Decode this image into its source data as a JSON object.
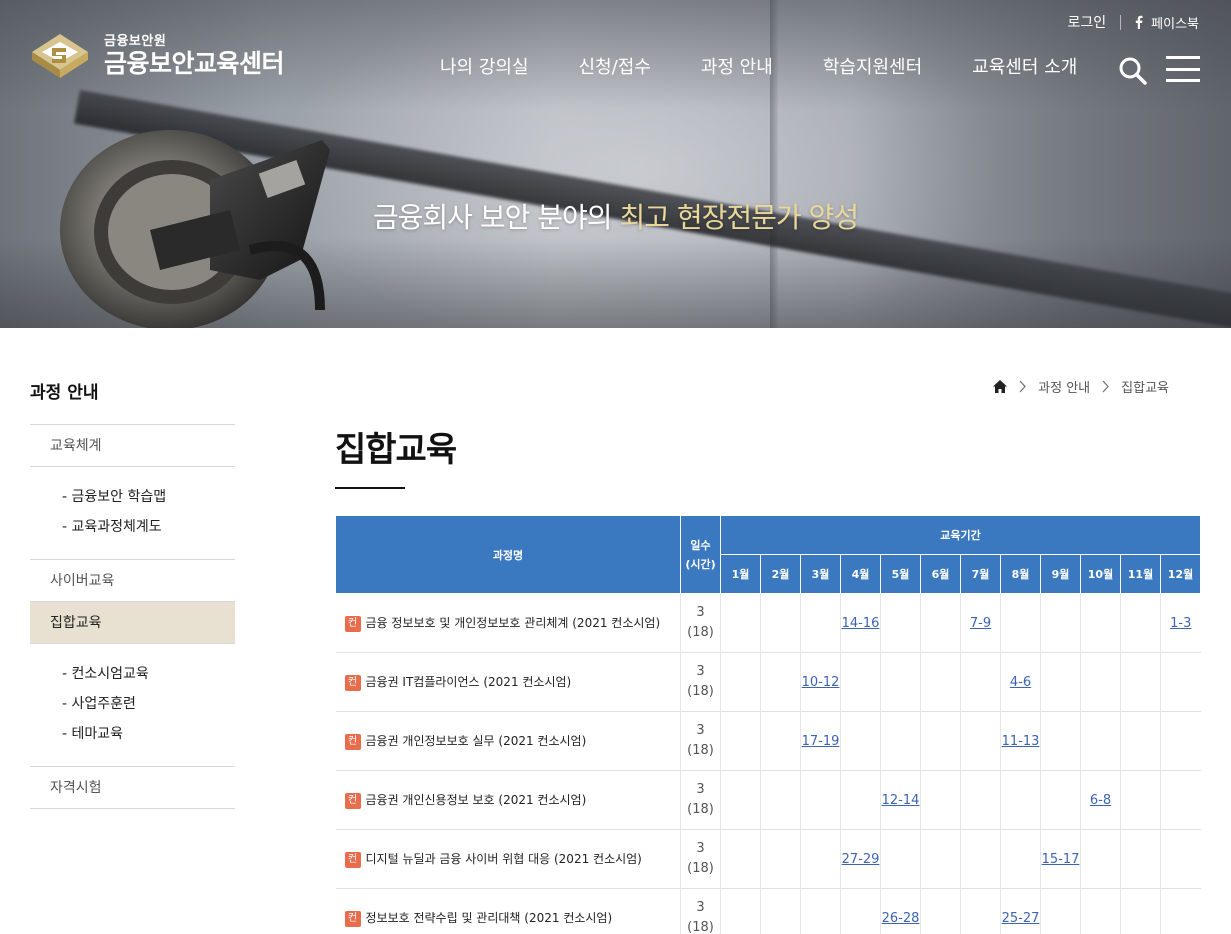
{
  "header": {
    "org": "금융보안원",
    "site_title": "금융보안교육센터",
    "login": "로그인",
    "facebook": "페이스북",
    "nav": [
      "나의 강의실",
      "신청/접수",
      "과정 안내",
      "학습지원센터",
      "교육센터 소개"
    ]
  },
  "hero": {
    "slogan_prefix": "금융회사 보안 분야의 ",
    "slogan_highlight": "최고 현장전문가 양성"
  },
  "sidebar": {
    "title": "과정 안내",
    "items": [
      {
        "label": "교육체계",
        "sub": [
          "- 금융보안 학습맵",
          "- 교육과정체계도"
        ]
      },
      {
        "label": "사이버교육"
      },
      {
        "label": "집합교육",
        "active": true,
        "sub": [
          "- 컨소시엄교육",
          "- 사업주훈련",
          "- 테마교육"
        ]
      },
      {
        "label": "자격시험"
      }
    ]
  },
  "breadcrumb": [
    "과정 안내",
    "집합교육"
  ],
  "page_title": "집합교육",
  "table": {
    "header_course": "과정명",
    "header_days": "일수",
    "header_hours": "(시간)",
    "header_period": "교육기간",
    "months": [
      "1월",
      "2월",
      "3월",
      "4월",
      "5월",
      "6월",
      "7월",
      "8월",
      "9월",
      "10월",
      "11월",
      "12월"
    ],
    "badge": "컨",
    "rows": [
      {
        "name": "금융 정보보호 및 개인정보보호 관리체계 (2021 컨소시엄)",
        "days": "3",
        "hours": "(18)",
        "dates": [
          "",
          "",
          "",
          "14-16",
          "",
          "",
          "7-9",
          "",
          "",
          "",
          "",
          "1-3"
        ]
      },
      {
        "name": "금융권 IT컴플라이언스 (2021 컨소시엄)",
        "days": "3",
        "hours": "(18)",
        "dates": [
          "",
          "",
          "10-12",
          "",
          "",
          "",
          "",
          "4-6",
          "",
          "",
          "",
          ""
        ]
      },
      {
        "name": "금융권 개인정보보호 실무 (2021 컨소시엄)",
        "days": "3",
        "hours": "(18)",
        "dates": [
          "",
          "",
          "17-19",
          "",
          "",
          "",
          "",
          "11-13",
          "",
          "",
          "",
          ""
        ]
      },
      {
        "name": "금융권 개인신용정보 보호 (2021 컨소시엄)",
        "days": "3",
        "hours": "(18)",
        "dates": [
          "",
          "",
          "",
          "",
          "12-14",
          "",
          "",
          "",
          "",
          "6-8",
          "",
          ""
        ]
      },
      {
        "name": "디지털 뉴딜과 금융 사이버 위협 대응 (2021 컨소시엄)",
        "days": "3",
        "hours": "(18)",
        "dates": [
          "",
          "",
          "",
          "27-29",
          "",
          "",
          "",
          "",
          "15-17",
          "",
          "",
          ""
        ]
      },
      {
        "name": "정보보호 전략수립 및 관리대책 (2021 컨소시엄)",
        "days": "3",
        "hours": "(18)",
        "dates": [
          "",
          "",
          "",
          "",
          "26-28",
          "",
          "",
          "25-27",
          "",
          "",
          "",
          ""
        ]
      }
    ]
  },
  "colors": {
    "table_header": "#3a78c0",
    "active_menu": "#e8e1d1",
    "badge": "#e86d4d",
    "link": "#3d63b4",
    "slogan_highlight": "#ead79a"
  },
  "icons": [
    "logo-mark-icon",
    "facebook-icon",
    "search-icon",
    "hamburger-menu-icon",
    "home-icon",
    "chevron-right-icon"
  ]
}
